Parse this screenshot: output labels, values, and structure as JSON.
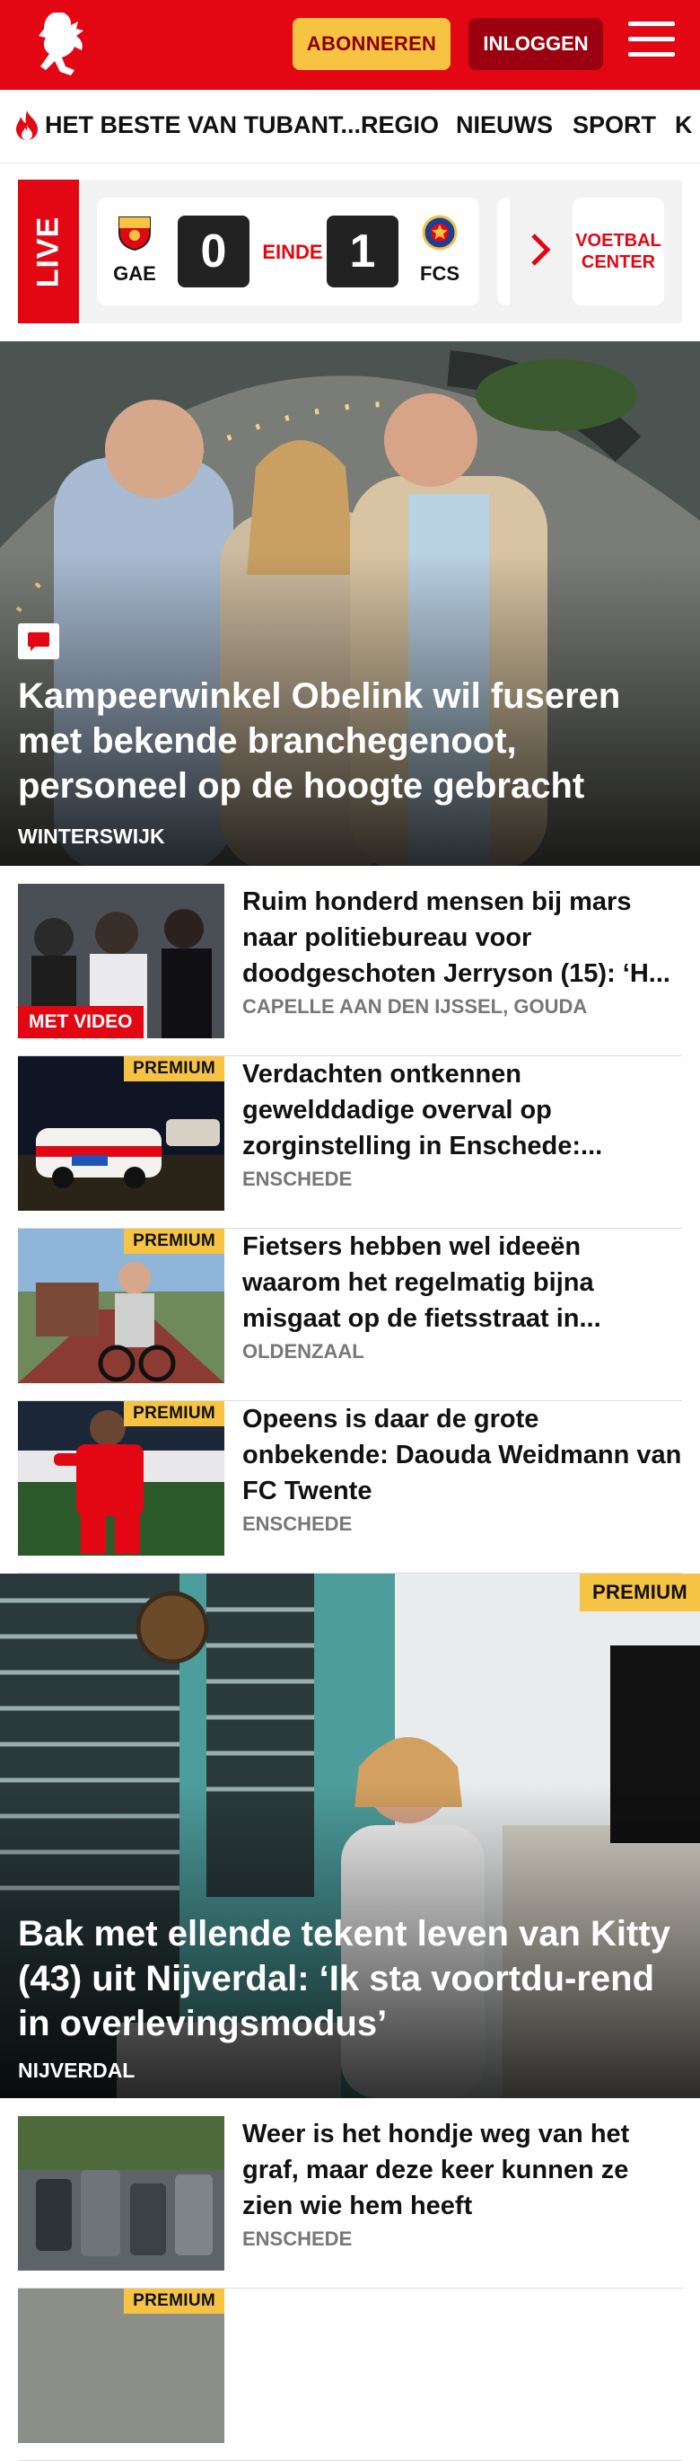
{
  "header": {
    "subscribe_label": "ABONNEREN",
    "login_label": "INLOGGEN",
    "logo_icon": "tubantia-horse-logo",
    "menu_icon": "hamburger-icon",
    "brand_color": "#e30613"
  },
  "nav": {
    "items": [
      {
        "label": "HET BESTE VAN TUBANT..."
      },
      {
        "label": "REGIO"
      },
      {
        "label": "NIEUWS"
      },
      {
        "label": "SPORT"
      },
      {
        "label": "K"
      }
    ]
  },
  "live": {
    "tag": "LIVE",
    "home_team": "GAE",
    "home_score": "0",
    "status": "EINDE",
    "away_score": "1",
    "away_team": "FCS",
    "voetbal_center": "VOETBAL CENTER"
  },
  "hero": {
    "title": "Kampeerwinkel Obelink wil fuseren met bekende branchegenoot, personeel op de hoogte gebracht",
    "kicker": "WINTERSWIJK"
  },
  "articles": [
    {
      "title": "Ruim honderd mensen bij mars naar politiebureau voor doodgeschoten Jerryson (15): ‘H...",
      "meta": "CAPELLE AAN DEN IJSSEL, GOUDA",
      "badge": "MET VIDEO"
    },
    {
      "title": "Verdachten ontkennen gewelddadige overval op zorginstelling in Enschede:...",
      "meta": "ENSCHEDE",
      "badge": "PREMIUM"
    },
    {
      "title": "Fietsers hebben wel ideeën waarom het regelmatig bijna misgaat op de fietsstraat in...",
      "meta": "OLDENZAAL",
      "badge": "PREMIUM"
    },
    {
      "title": "Opeens is daar de grote onbekende: Daouda Weidmann van FC Twente",
      "meta": "ENSCHEDE",
      "badge": "PREMIUM"
    }
  ],
  "hero2": {
    "badge": "PREMIUM",
    "title": "Bak met ellende tekent leven van Kitty (43) uit Nijverdal: ‘Ik sta voortdu-rend in overlevingsmodus’",
    "kicker": "NIJVERDAL"
  },
  "articles2": [
    {
      "title": "Weer is het hondje weg van het graf, maar deze keer kunnen ze zien wie hem heeft",
      "meta": "ENSCHEDE"
    },
    {
      "title": "",
      "meta": "",
      "badge": "PREMIUM"
    }
  ]
}
